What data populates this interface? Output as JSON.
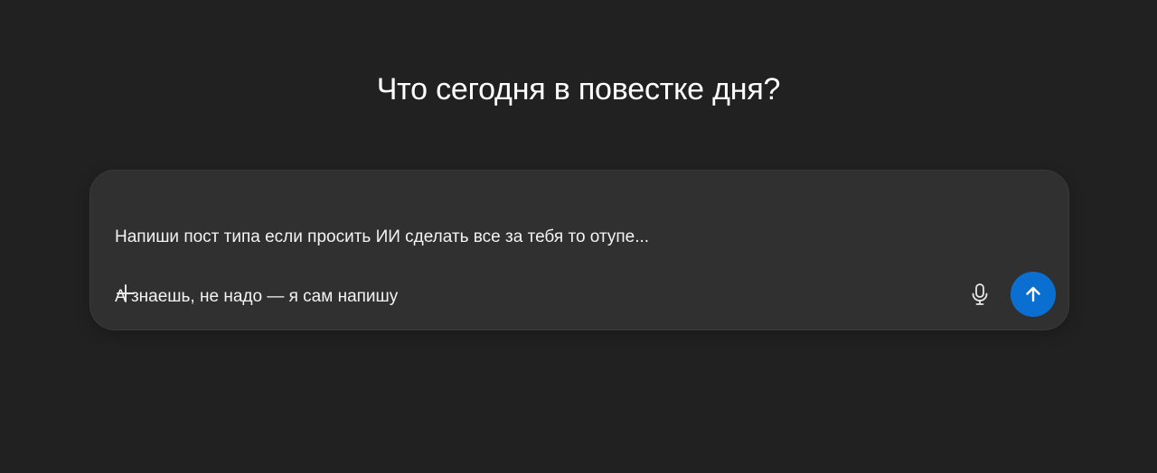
{
  "headline": "Что сегодня в повестке дня?",
  "composer": {
    "lines": [
      "Напиши пост типа если просить ИИ сделать все за тебя то отупе...",
      "А знаешь, не надо — я сам напишу"
    ],
    "icons": {
      "add": "plus-icon",
      "mic": "microphone-icon",
      "send": "arrow-up-icon"
    }
  },
  "colors": {
    "background": "#212121",
    "composer_bg": "#303030",
    "send_accent": "#0b6fd1"
  }
}
